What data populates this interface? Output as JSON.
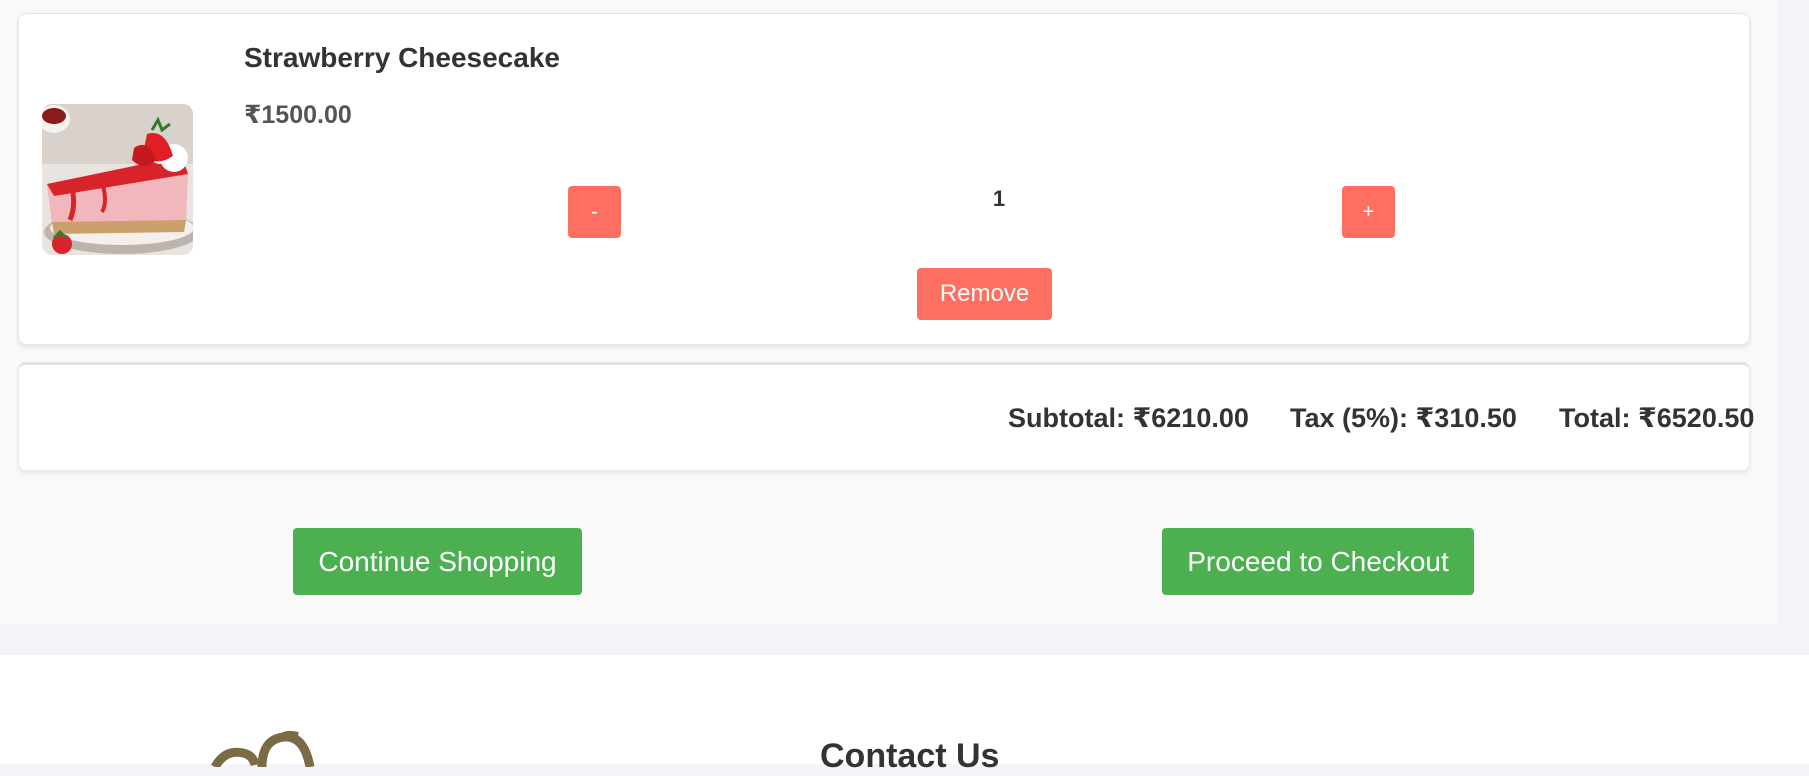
{
  "cart_item": {
    "name": "Strawberry Cheesecake",
    "price": "₹1500.00",
    "quantity": "1",
    "decrease_label": "-",
    "increase_label": "+",
    "remove_label": "Remove",
    "image_icon": "strawberry-cheesecake-photo"
  },
  "summary": {
    "subtotal": "Subtotal: ₹6210.00",
    "tax": "Tax (5%): ₹310.50",
    "total": "Total: ₹6520.50"
  },
  "actions": {
    "continue_label": "Continue Shopping",
    "checkout_label": "Proceed to Checkout"
  },
  "footer": {
    "contact_heading": "Contact Us",
    "logo_icon": "brand-logo"
  },
  "colors": {
    "danger": "#ff6f61",
    "success": "#4caf50",
    "text": "#333333",
    "background": "#f9f9f9"
  }
}
